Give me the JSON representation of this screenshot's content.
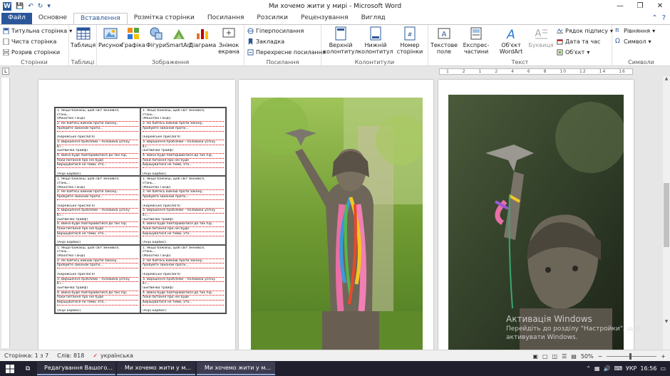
{
  "window": {
    "title": "Ми хочемо жити у мирі  -  Microsoft Word",
    "minimize": "—",
    "restore": "❐",
    "close": "✕"
  },
  "quick_access": {
    "icons": [
      "word-logo-icon",
      "save-icon",
      "undo-icon",
      "redo-icon",
      "customize-icon"
    ],
    "glyphs": {
      "logo": "W",
      "save": "💾",
      "undo": "↶",
      "redo": "↻",
      "customize": "▾"
    }
  },
  "tabs": [
    "Файл",
    "Основне",
    "Вставлення",
    "Розмітка сторінки",
    "Посилання",
    "Розсилки",
    "Рецензування",
    "Вигляд"
  ],
  "tabs_active_index": 2,
  "tab_right": {
    "help": "?",
    "collapse": "⌃"
  },
  "ribbon": {
    "pages": {
      "label": "Сторінки",
      "items": [
        "Титульна сторінка",
        "Чиста сторінка",
        "Розрив сторінки"
      ]
    },
    "tables": {
      "label": "Таблиці",
      "button": "Таблиця"
    },
    "illustrations": {
      "label": "Зображення",
      "buttons": [
        "Рисунок",
        "Графіка",
        "Фігури",
        "SmartArt",
        "Діаграма",
        "Знімок екрана"
      ]
    },
    "links": {
      "label": "Посилання",
      "items": [
        "Гіперпосилання",
        "Закладка",
        "Перехресне посилання"
      ]
    },
    "header_footer": {
      "label": "Колонтитули",
      "buttons": [
        "Верхній колонтитул",
        "Нижній колонтитул",
        "Номер сторінки"
      ]
    },
    "text": {
      "label": "Текст",
      "buttons": [
        "Текстове поле",
        "Експрес-частини",
        "Об'єкт WordArt",
        "Буквиця"
      ],
      "items": [
        "Рядок підпису",
        "Дата та час",
        "Об'єкт"
      ]
    },
    "symbols": {
      "label": "Символи",
      "items": [
        "Рівняння",
        "Символ"
      ]
    }
  },
  "ruler": {
    "ticks": [
      "1",
      "2",
      "1",
      "2",
      "4",
      "6",
      "8",
      "10",
      "12",
      "14",
      "16"
    ],
    "tab_selector": "L"
  },
  "document": {
    "cell_lines": [
      "1. Якщо бажаєш, щоб світ змінився,",
      "стань...",
      "(Махатма Ганді)",
      "2. Не бійтесь війною проти закону,",
      "пробуйте законом проти...",
      "",
      "(Єврейське прислів'я)",
      "3. Вирішення проблеми – половина успіху",
      "в ї...",
      "(Битвичва трайф)",
      "4. Війна буде повторюватися до тих пір,",
      "поки питання про неї буде",
      "вирішуватися не тими, хто...",
      "",
      "(Анрі Барбюс)"
    ]
  },
  "watermark": {
    "line1": "Активація Windows",
    "line2": "Перейдіть до розділу \"Настройки\", щоб",
    "line3": "активувати Windows."
  },
  "status": {
    "page": "Сторінка: 1 з 7",
    "words": "Слів: 818",
    "language": "українська",
    "zoom": "50%",
    "zoom_minus": "−",
    "zoom_plus": "+"
  },
  "taskbar": {
    "apps": [
      {
        "label": "Редагування Вашого...",
        "icon": "chrome-icon"
      },
      {
        "label": "Ми хочемо жити у м...",
        "icon": "folder-icon"
      },
      {
        "label": "Ми хочемо жити у м...",
        "icon": "word-icon"
      }
    ],
    "lang": "УКР",
    "time": "16:56"
  }
}
